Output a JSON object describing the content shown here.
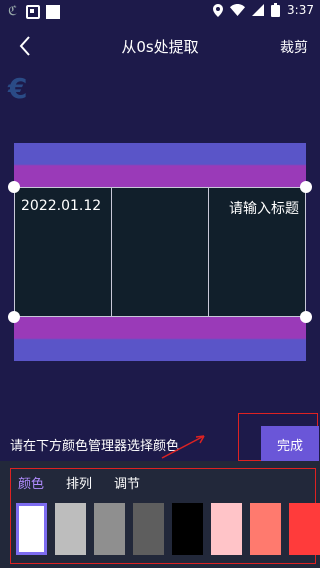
{
  "status_bar": {
    "time": "3:37"
  },
  "header": {
    "title": "从0s处提取",
    "crop_label": "裁剪"
  },
  "preview": {
    "left_text": "2022.01.12",
    "right_text": "请输入标题"
  },
  "hint": {
    "text": "请在下方颜色管理器选择颜色"
  },
  "done_button": {
    "label": "完成"
  },
  "tabs": [
    {
      "label": "颜色",
      "active": true
    },
    {
      "label": "排列",
      "active": false
    },
    {
      "label": "调节",
      "active": false
    }
  ],
  "swatches": [
    {
      "color": "#ffffff",
      "selected": true
    },
    {
      "color": "#bdbdbd",
      "selected": false
    },
    {
      "color": "#8f8f8f",
      "selected": false
    },
    {
      "color": "#5e5e5e",
      "selected": false
    },
    {
      "color": "#000000",
      "selected": false
    },
    {
      "color": "#ffc4c8",
      "selected": false
    },
    {
      "color": "#ff7a6e",
      "selected": false
    },
    {
      "color": "#ff3b3b",
      "selected": false
    }
  ],
  "colors": {
    "accent": "#6a56d8",
    "annotation": "#dd2222",
    "background": "#1d1a4a"
  }
}
